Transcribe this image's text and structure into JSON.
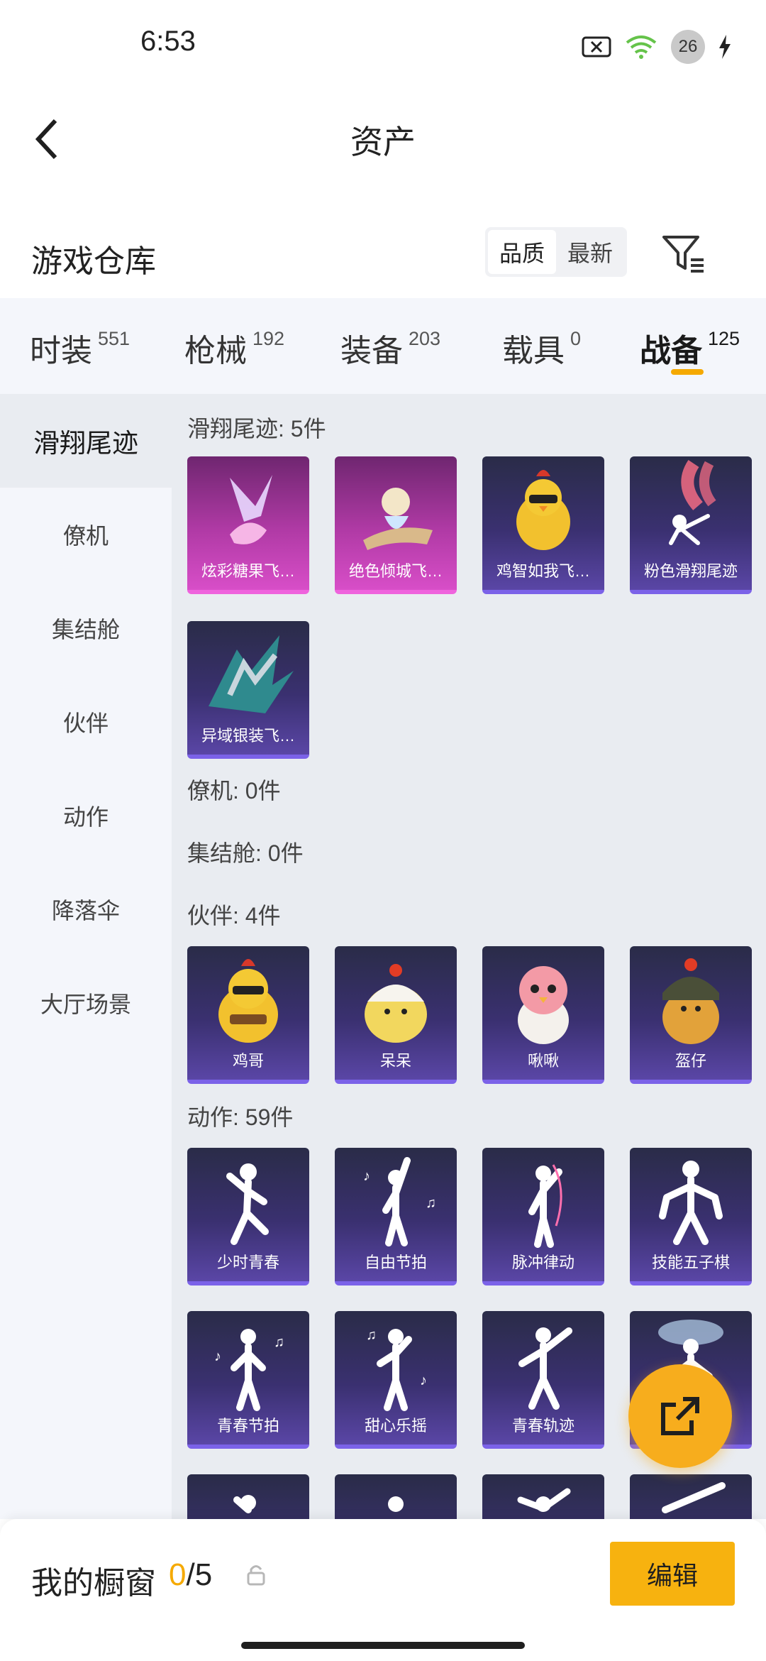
{
  "status_bar": {
    "time": "6:53",
    "battery": "26"
  },
  "header": {
    "title": "资产"
  },
  "warehouse": {
    "title": "游戏仓库",
    "sort_options": [
      "品质",
      "最新"
    ],
    "active_sort": "品质"
  },
  "tabs": [
    {
      "label": "时装",
      "count": "551"
    },
    {
      "label": "枪械",
      "count": "192"
    },
    {
      "label": "装备",
      "count": "203"
    },
    {
      "label": "载具",
      "count": "0"
    },
    {
      "label": "战备",
      "count": "125",
      "active": true
    }
  ],
  "sidebar": {
    "items": [
      "滑翔尾迹",
      "僚机",
      "集结舱",
      "伙伴",
      "动作",
      "降落伞",
      "大厅场景"
    ],
    "active": "滑翔尾迹"
  },
  "sections": {
    "glide": {
      "title": "滑翔尾迹: 5件",
      "items": [
        "炫彩糖果飞…",
        "绝色倾城飞…",
        "鸡智如我飞…",
        "粉色滑翔尾迹",
        "异域银装飞…"
      ]
    },
    "wingman": {
      "title": "僚机: 0件"
    },
    "pod": {
      "title": "集结舱: 0件"
    },
    "partner": {
      "title": "伙伴: 4件",
      "items": [
        "鸡哥",
        "呆呆",
        "啾啾",
        "盔仔"
      ]
    },
    "emote": {
      "title": "动作: 59件",
      "items": [
        "少时青春",
        "自由节拍",
        "脉冲律动",
        "技能五子棋",
        "青春节拍",
        "甜心乐摇",
        "青春轨迹",
        ""
      ]
    }
  },
  "bottom": {
    "showcase_label": "我的橱窗",
    "showcase_current": "0",
    "showcase_total": "/5",
    "edit_label": "编辑"
  },
  "colors": {
    "accent": "#f5a900",
    "card_purple": "#3a3070",
    "card_pink": "#b03aa5"
  }
}
